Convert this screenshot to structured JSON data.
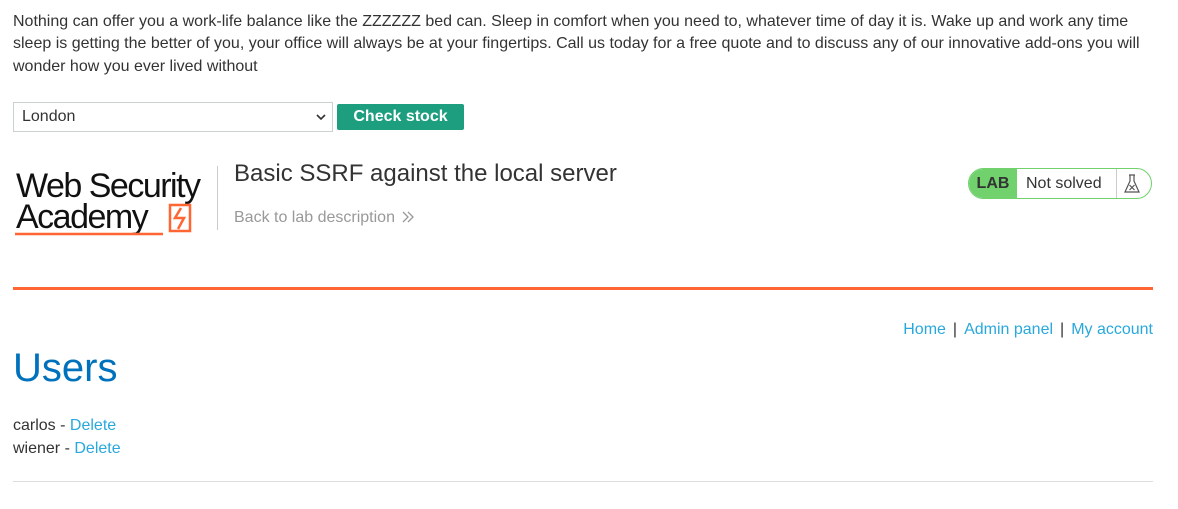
{
  "product": {
    "description": "Nothing can offer you a work-life balance like the ZZZZZZ bed can. Sleep in comfort when you need to, whatever time of day it is. Wake up and work any time sleep is getting the better of you, your office will always be at your fingertips. Call us today for a free quote and to discuss any of our innovative add-ons you will wonder how you ever lived without"
  },
  "stock_check": {
    "selected_store": "London",
    "button_label": "Check stock"
  },
  "academy": {
    "logo_text": "Web Security Academy",
    "lab_title": "Basic SSRF against the local server",
    "back_link_label": "Back to lab description",
    "lab_badge": "LAB",
    "lab_status": "Not solved",
    "status_color": "#70d16d"
  },
  "nav": {
    "home": "Home",
    "admin_panel": "Admin panel",
    "my_account": "My account",
    "separator": "|"
  },
  "admin": {
    "heading": "Users",
    "users": [
      {
        "name": "carlos",
        "separator": " - ",
        "action": "Delete"
      },
      {
        "name": "wiener",
        "separator": " - ",
        "action": "Delete"
      }
    ]
  },
  "colors": {
    "accent_orange": "#ff6633",
    "link_blue": "#29a8dc",
    "heading_blue": "#0071bc",
    "button_green": "#1d9e7e"
  }
}
